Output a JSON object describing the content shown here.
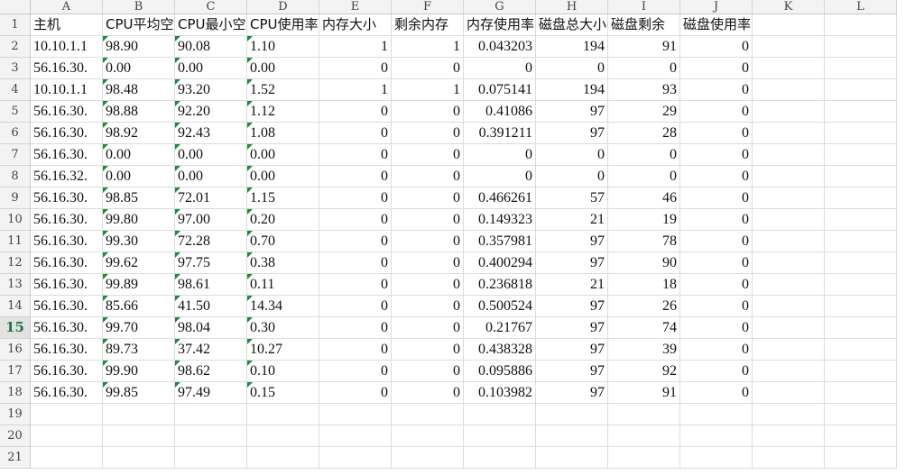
{
  "columns": [
    "A",
    "B",
    "C",
    "D",
    "E",
    "F",
    "G",
    "H",
    "I",
    "J",
    "K",
    "L"
  ],
  "row_numbers": [
    "1",
    "2",
    "3",
    "4",
    "5",
    "6",
    "7",
    "8",
    "9",
    "10",
    "11",
    "12",
    "13",
    "14",
    "15",
    "16",
    "17",
    "18",
    "19",
    "20",
    "21"
  ],
  "active_row": "15",
  "headers": [
    "主机",
    "CPU平均空",
    "CPU最小空",
    "CPU使用率",
    "内存大小",
    "剩余内存",
    "内存使用率",
    "磁盘总大小",
    "磁盘剩余",
    "磁盘使用率(%)"
  ],
  "rows": [
    [
      "10.10.1.1",
      "98.90",
      "90.08",
      "1.10",
      "1",
      "1",
      "0.043203",
      "194",
      "91",
      "0"
    ],
    [
      "56.16.30.",
      "0.00",
      "0.00",
      "0.00",
      "0",
      "0",
      "0",
      "0",
      "0",
      "0"
    ],
    [
      "10.10.1.1",
      "98.48",
      "93.20",
      "1.52",
      "1",
      "1",
      "0.075141",
      "194",
      "93",
      "0"
    ],
    [
      "56.16.30.",
      "98.88",
      "92.20",
      "1.12",
      "0",
      "0",
      "0.41086",
      "97",
      "29",
      "0"
    ],
    [
      "56.16.30.",
      "98.92",
      "92.43",
      "1.08",
      "0",
      "0",
      "0.391211",
      "97",
      "28",
      "0"
    ],
    [
      "56.16.30.",
      "0.00",
      "0.00",
      "0.00",
      "0",
      "0",
      "0",
      "0",
      "0",
      "0"
    ],
    [
      "56.16.32.",
      "0.00",
      "0.00",
      "0.00",
      "0",
      "0",
      "0",
      "0",
      "0",
      "0"
    ],
    [
      "56.16.30.",
      "98.85",
      "72.01",
      "1.15",
      "0",
      "0",
      "0.466261",
      "57",
      "46",
      "0"
    ],
    [
      "56.16.30.",
      "99.80",
      "97.00",
      "0.20",
      "0",
      "0",
      "0.149323",
      "21",
      "19",
      "0"
    ],
    [
      "56.16.30.",
      "99.30",
      "72.28",
      "0.70",
      "0",
      "0",
      "0.357981",
      "97",
      "78",
      "0"
    ],
    [
      "56.16.30.",
      "99.62",
      "97.75",
      "0.38",
      "0",
      "0",
      "0.400294",
      "97",
      "90",
      "0"
    ],
    [
      "56.16.30.",
      "99.89",
      "98.61",
      "0.11",
      "0",
      "0",
      "0.236818",
      "21",
      "18",
      "0"
    ],
    [
      "56.16.30.",
      "85.66",
      "41.50",
      "14.34",
      "0",
      "0",
      "0.500524",
      "97",
      "26",
      "0"
    ],
    [
      "56.16.30.",
      "99.70",
      "98.04",
      "0.30",
      "0",
      "0",
      "0.21767",
      "97",
      "74",
      "0"
    ],
    [
      "56.16.30.",
      "89.73",
      "37.42",
      "10.27",
      "0",
      "0",
      "0.438328",
      "97",
      "39",
      "0"
    ],
    [
      "56.16.30.",
      "99.90",
      "98.62",
      "0.10",
      "0",
      "0",
      "0.095886",
      "97",
      "92",
      "0"
    ],
    [
      "56.16.30.",
      "99.85",
      "97.49",
      "0.15",
      "0",
      "0",
      "0.103982",
      "97",
      "91",
      "0"
    ]
  ]
}
